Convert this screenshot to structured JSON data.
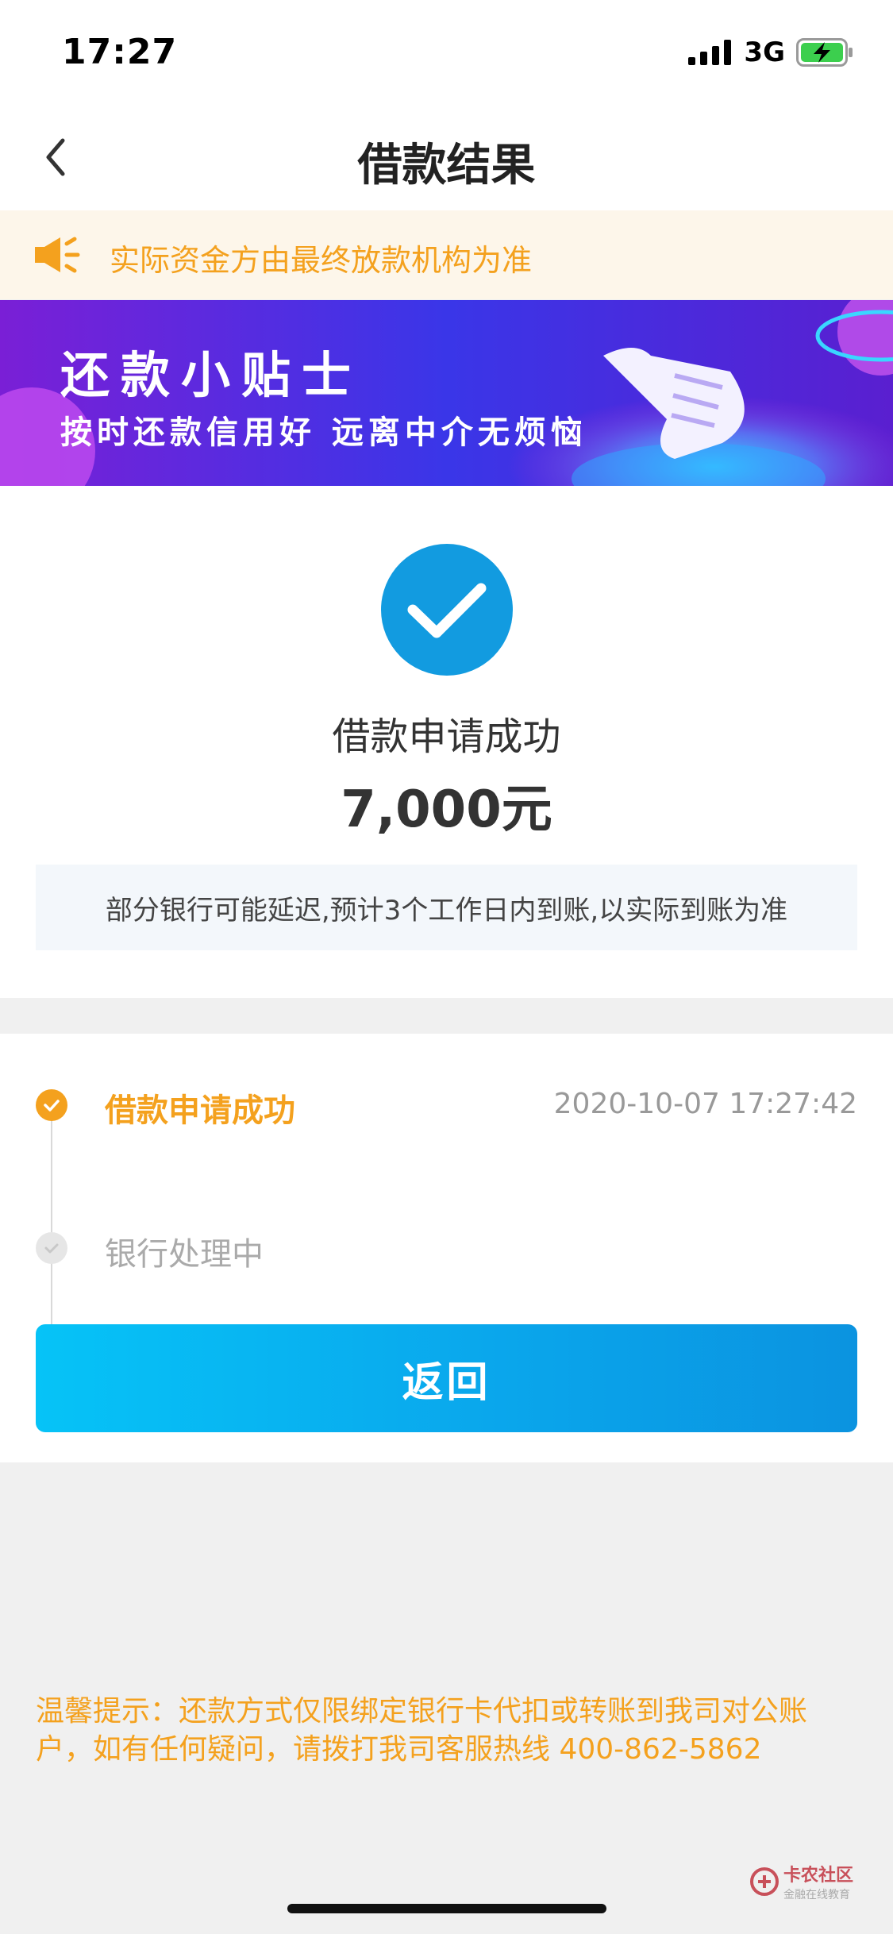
{
  "status_bar": {
    "time": "17:27",
    "network": "3G",
    "icons": [
      "signal-icon",
      "battery-charging-icon"
    ]
  },
  "nav": {
    "title": "借款结果",
    "back_icon": "chevron-left-icon"
  },
  "notice": {
    "icon": "speaker-icon",
    "text": "实际资金方由最终放款机构为准"
  },
  "banner": {
    "title": "还款小贴士",
    "subtitle": "按时还款信用好 远离中介无烦恼"
  },
  "result": {
    "icon": "check-circle-icon",
    "title": "借款申请成功",
    "amount": "7,000元",
    "note": "部分银行可能延迟,预计3个工作日内到账,以实际到账为准"
  },
  "progress": {
    "steps": [
      {
        "label": "借款申请成功",
        "time": "2020-10-07 17:27:42",
        "status": "done"
      },
      {
        "label": "银行处理中",
        "time": "",
        "status": "pending"
      }
    ]
  },
  "actions": {
    "return_label": "返回"
  },
  "tip": {
    "text": "温馨提示：还款方式仅限绑定银行卡代扣或转账到我司对公账户，如有任何疑问，请拨打我司客服热线 400-862-5862"
  },
  "watermark": {
    "main": "卡农社区",
    "sub": "金融在线教育"
  },
  "colors": {
    "accent_orange": "#f4a11e",
    "primary_blue": "#129be0",
    "button_blue": "#0aa7ec"
  }
}
